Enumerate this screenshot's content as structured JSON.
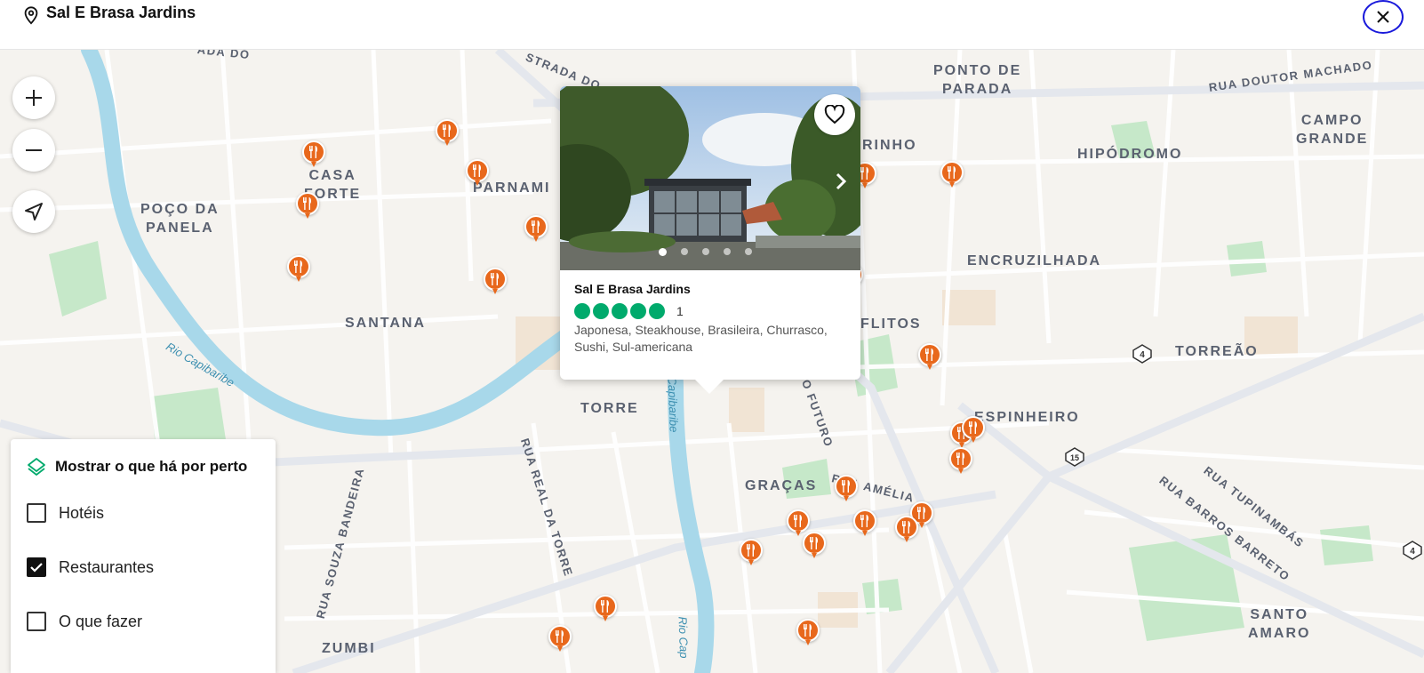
{
  "header": {
    "location_title": "Sal E Brasa Jardins",
    "close_label": "×"
  },
  "map": {
    "neighborhoods": [
      "POÇO DA\nPANELA",
      "CASA\nFORTE",
      "PARNAMI",
      "SANTANA",
      "TORRE",
      "GRAÇAS",
      "FLITOS",
      "ESPINHEIRO",
      "ENCRUZILHADA",
      "HIPÓDROMO",
      "CAMPO\nGRANDE",
      "PONTO DE\nPARADA",
      "TORREÃO",
      "SANTO\nAMARO",
      "ZUMBI",
      "RINHO"
    ],
    "streets": [
      "RUA DOUTOR MACHADO",
      "RUA REAL DA TORRE",
      "RUA SOUZA BANDEIRA",
      "RUA TUPINAMBÁS",
      "RUA BARROS BARRETO",
      "RUA AMÉLIA",
      "O FUTURO",
      "STRADA DO",
      "ADA DO"
    ],
    "rivers": [
      "Rio Capibaribe",
      "Capibaribe",
      "Rio Cap"
    ],
    "highway_shields": [
      "4",
      "15",
      "4"
    ],
    "controls": {
      "zoom_in": "+",
      "zoom_out": "−"
    }
  },
  "popup": {
    "name": "Sal E Brasa Jardins",
    "rating_bubbles": 5,
    "review_count": "1",
    "cuisines": "Japonesa, Steakhouse, Brasileira, Churrasco, Sushi, Sul-americana",
    "photo_count": 5,
    "active_photo": 0
  },
  "legend": {
    "title": "Mostrar o que há por perto",
    "options": [
      {
        "label": "Hotéis",
        "checked": false
      },
      {
        "label": "Restaurantes",
        "checked": true
      },
      {
        "label": "O que fazer",
        "checked": false
      }
    ]
  },
  "colors": {
    "marker": "#e8681c",
    "rating_bubble": "#00aa6c",
    "close_border": "#1a1adb",
    "river": "#a8d8ea",
    "park": "#c6e8c9",
    "road": "#ffffff"
  }
}
